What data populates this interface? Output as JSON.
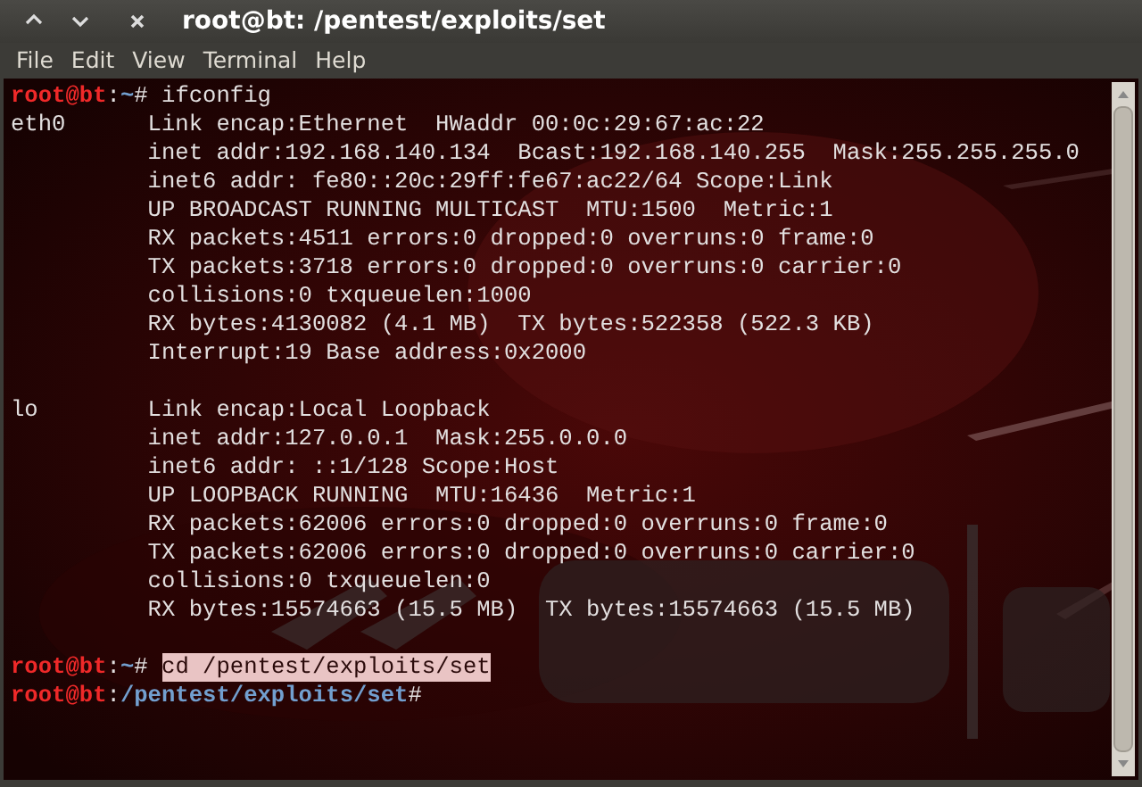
{
  "window": {
    "title": "root@bt: /pentest/exploits/set"
  },
  "menu": [
    "File",
    "Edit",
    "View",
    "Terminal",
    "Help"
  ],
  "terminal": {
    "lines": [
      {
        "kind": "prompt",
        "user": "root@bt",
        "separator": ":",
        "path": "~",
        "symbol": "#",
        "command": "ifconfig",
        "selected": false
      },
      {
        "kind": "output",
        "text": "eth0      Link encap:Ethernet  HWaddr 00:0c:29:67:ac:22"
      },
      {
        "kind": "output",
        "text": "          inet addr:192.168.140.134  Bcast:192.168.140.255  Mask:255.255.255.0"
      },
      {
        "kind": "output",
        "text": "          inet6 addr: fe80::20c:29ff:fe67:ac22/64 Scope:Link"
      },
      {
        "kind": "output",
        "text": "          UP BROADCAST RUNNING MULTICAST  MTU:1500  Metric:1"
      },
      {
        "kind": "output",
        "text": "          RX packets:4511 errors:0 dropped:0 overruns:0 frame:0"
      },
      {
        "kind": "output",
        "text": "          TX packets:3718 errors:0 dropped:0 overruns:0 carrier:0"
      },
      {
        "kind": "output",
        "text": "          collisions:0 txqueuelen:1000"
      },
      {
        "kind": "output",
        "text": "          RX bytes:4130082 (4.1 MB)  TX bytes:522358 (522.3 KB)"
      },
      {
        "kind": "output",
        "text": "          Interrupt:19 Base address:0x2000"
      },
      {
        "kind": "blank"
      },
      {
        "kind": "output",
        "text": "lo        Link encap:Local Loopback"
      },
      {
        "kind": "output",
        "text": "          inet addr:127.0.0.1  Mask:255.0.0.0"
      },
      {
        "kind": "output",
        "text": "          inet6 addr: ::1/128 Scope:Host"
      },
      {
        "kind": "output",
        "text": "          UP LOOPBACK RUNNING  MTU:16436  Metric:1"
      },
      {
        "kind": "output",
        "text": "          RX packets:62006 errors:0 dropped:0 overruns:0 frame:0"
      },
      {
        "kind": "output",
        "text": "          TX packets:62006 errors:0 dropped:0 overruns:0 carrier:0"
      },
      {
        "kind": "output",
        "text": "          collisions:0 txqueuelen:0"
      },
      {
        "kind": "output",
        "text": "          RX bytes:15574663 (15.5 MB)  TX bytes:15574663 (15.5 MB)"
      },
      {
        "kind": "blank"
      },
      {
        "kind": "prompt",
        "user": "root@bt",
        "separator": ":",
        "path": "~",
        "symbol": "#",
        "command": "cd /pentest/exploits/set",
        "selected": true
      },
      {
        "kind": "prompt",
        "user": "root@bt",
        "separator": ":",
        "path": "/pentest/exploits/set",
        "symbol": "#"
      }
    ]
  }
}
